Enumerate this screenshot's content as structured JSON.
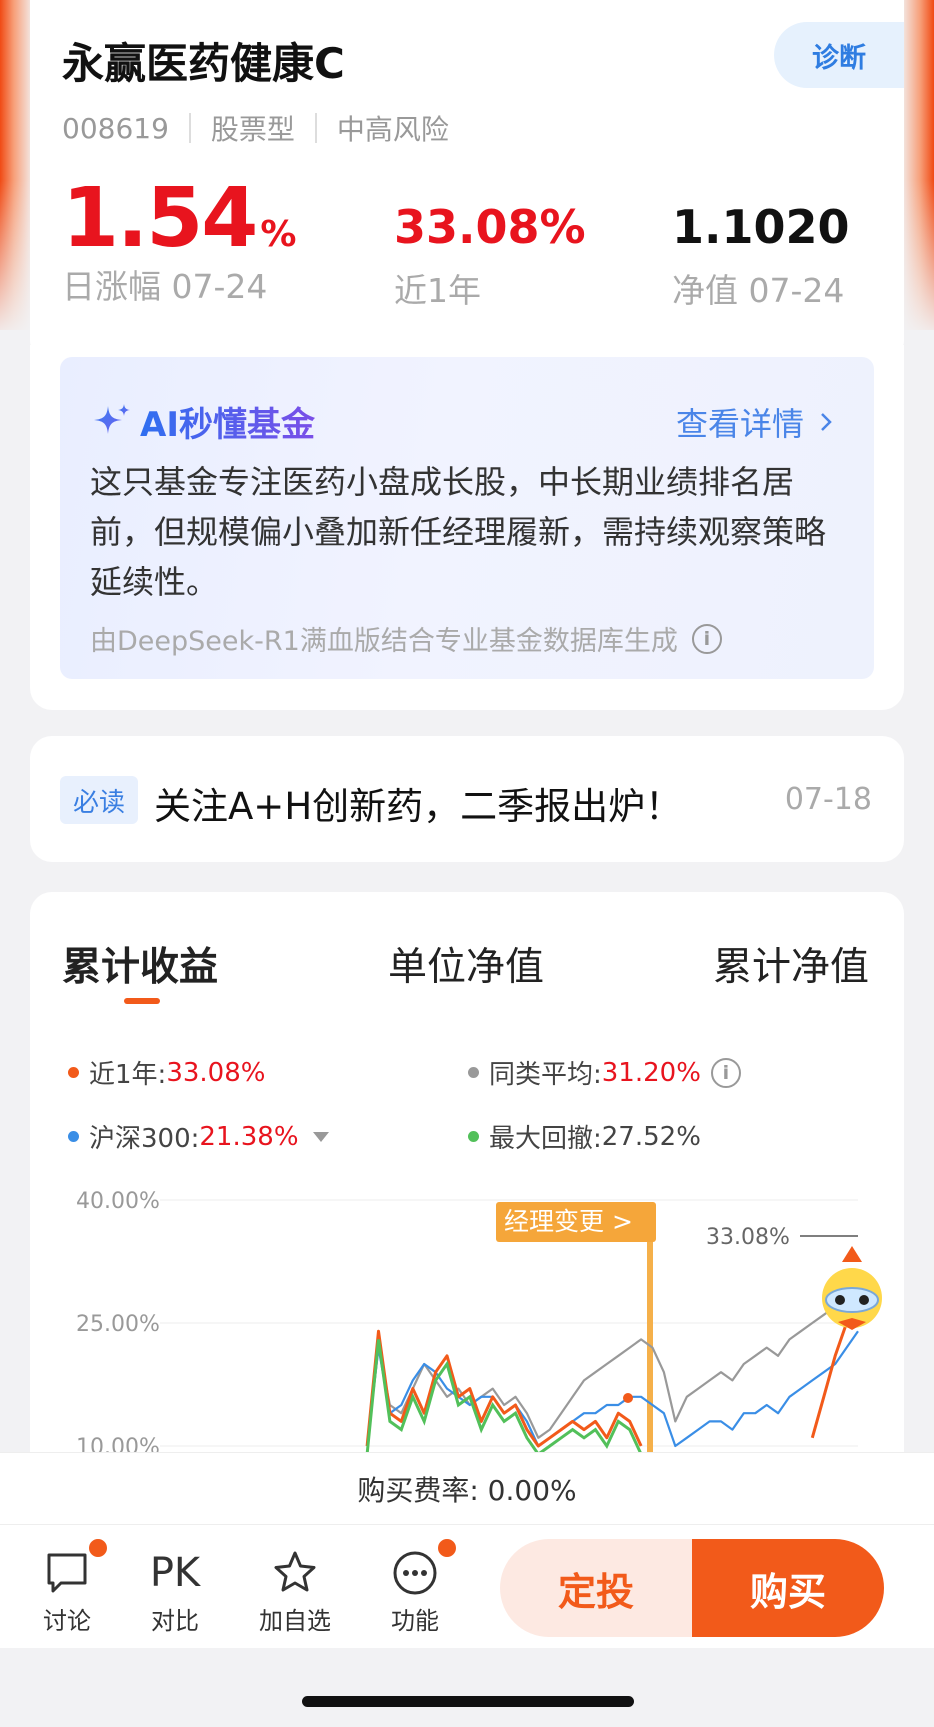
{
  "fund": {
    "name": "永赢医药健康C",
    "code": "008619",
    "type": "股票型",
    "risk": "中高风险",
    "diagnose_label": "诊断",
    "daily_change_value": "1.54",
    "daily_change_unit": "%",
    "daily_change_label": "日涨幅 07-24",
    "year_return_value": "33.08%",
    "year_return_label": "近1年",
    "nav_value": "1.1020",
    "nav_label": "净值 07-24"
  },
  "ai": {
    "title": "AI秒懂基金",
    "more_label": "查看详情",
    "body": "这只基金专注医药小盘成长股，中长期业绩排名居前，但规模偏小叠加新任经理履新，需持续观察策略延续性。",
    "footer": "由DeepSeek-R1满血版结合专业基金数据库生成"
  },
  "news": {
    "tag": "必读",
    "title": "关注A+H创新药，二季报出炉！",
    "date": "07-18"
  },
  "chart_tabs": [
    "累计收益",
    "单位净值",
    "累计净值"
  ],
  "legend": {
    "year_label": "近1年:",
    "year_value": "33.08%",
    "peer_label": "同类平均:",
    "peer_value": "31.20%",
    "hs300_label": "沪深300:",
    "hs300_value": "21.38%",
    "drawdown_label": "最大回撤:",
    "drawdown_value": "27.52%"
  },
  "colors": {
    "fund": "#f25a1a",
    "peer": "#999999",
    "hs300": "#3a8ee6",
    "drawdown": "#52c05a",
    "accent": "#f25a1a",
    "rise": "#e8141e"
  },
  "chart_data": {
    "type": "line",
    "y_ticks": [
      "40.00%",
      "25.00%",
      "10.00%"
    ],
    "ylim": [
      10,
      40
    ],
    "end_label": "33.08%",
    "annotation": "经理变更 >",
    "series": [
      {
        "key": "fund",
        "values": [
          null,
          null,
          null,
          null,
          null,
          10,
          24,
          14,
          13,
          17,
          14,
          19,
          21,
          16,
          17,
          13,
          16,
          14,
          15,
          12,
          10,
          11,
          12,
          13,
          12,
          13,
          11,
          14,
          13,
          10,
          null,
          null,
          null,
          null,
          null,
          null,
          null,
          null,
          null,
          null,
          null,
          null,
          null,
          null,
          11,
          16,
          21,
          25,
          28
        ]
      },
      {
        "key": "peer",
        "values": [
          null,
          null,
          null,
          null,
          null,
          10,
          22,
          15,
          14,
          17,
          20,
          18,
          16,
          17,
          15,
          16,
          17,
          15,
          16,
          14,
          11,
          12,
          14,
          16,
          18,
          19,
          20,
          21,
          22,
          23,
          22,
          19,
          13,
          16,
          17,
          18,
          19,
          18,
          20,
          21,
          22,
          21,
          23,
          24,
          25,
          26,
          27,
          28,
          29
        ]
      },
      {
        "key": "hs300",
        "values": [
          null,
          null,
          null,
          null,
          null,
          10,
          22,
          14,
          15,
          18,
          20,
          19,
          17,
          16,
          15,
          16,
          16,
          14,
          15,
          13,
          10,
          11,
          12,
          13,
          14,
          14,
          15,
          15,
          16,
          16,
          15,
          14,
          10,
          11,
          12,
          13,
          13,
          12,
          14,
          14,
          15,
          14,
          16,
          17,
          18,
          19,
          20,
          22,
          24
        ]
      }
    ]
  },
  "fee": "购买费率: 0.00%",
  "bottom_nav": [
    {
      "label": "讨论"
    },
    {
      "label": "对比",
      "icon_text": "PK"
    },
    {
      "label": "加自选"
    },
    {
      "label": "功能"
    }
  ],
  "actions": {
    "sip": "定投",
    "buy": "购买"
  }
}
